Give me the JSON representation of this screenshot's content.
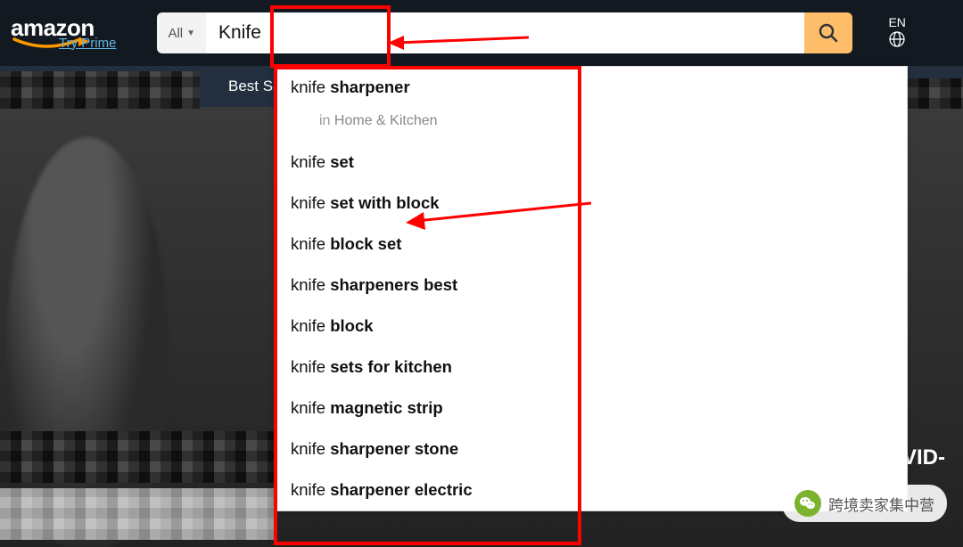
{
  "header": {
    "logo": "amazon",
    "try_prime": "Try Prime",
    "category_selector": "All",
    "search_value": "Knife",
    "lang_label": "EN"
  },
  "subnav": {
    "best_sellers_fragment": "Best Se"
  },
  "suggestions": [
    {
      "prefix": "knife ",
      "bold": "sharpener",
      "category_hint": {
        "in": "in ",
        "name": "Home & Kitchen"
      }
    },
    {
      "prefix": "knife ",
      "bold": "set"
    },
    {
      "prefix": "knife ",
      "bold": "set with block"
    },
    {
      "prefix": "knife ",
      "bold": "block set"
    },
    {
      "prefix": "knife ",
      "bold": "sharpeners best"
    },
    {
      "prefix": "knife ",
      "bold": "block"
    },
    {
      "prefix": "knife ",
      "bold": "sets for kitchen"
    },
    {
      "prefix": "knife ",
      "bold": "magnetic strip"
    },
    {
      "prefix": "knife ",
      "bold": "sharpener stone"
    },
    {
      "prefix": "knife ",
      "bold": "sharpener electric"
    }
  ],
  "hero": {
    "partial_text": "VID-"
  },
  "watermark": {
    "text": "跨境卖家集中营"
  }
}
